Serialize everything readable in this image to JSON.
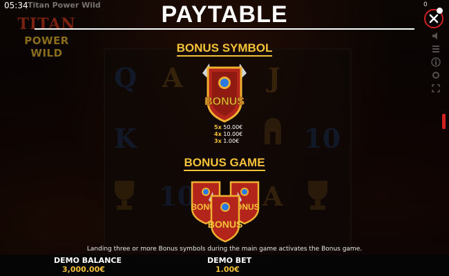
{
  "status": {
    "time": "05:34",
    "game_title": "Titan Power Wild",
    "counter": "0"
  },
  "logo": {
    "line1": "TITAN",
    "line2": "POWER WILD"
  },
  "paytable": {
    "title": "PAYTABLE",
    "bonus_symbol": {
      "heading": "BONUS SYMBOL",
      "symbol_text": "BONUS",
      "payouts": [
        {
          "count": "5x",
          "value": "50.00€"
        },
        {
          "count": "4x",
          "value": "10.00€"
        },
        {
          "count": "3x",
          "value": "1.00€"
        }
      ]
    },
    "bonus_game": {
      "heading": "BONUS GAME",
      "symbol_text": "BONUS",
      "description": "Landing three or more Bonus symbols during the main game activates the Bonus game."
    }
  },
  "reels": {
    "symbols": [
      "Q",
      "A",
      "J",
      "K",
      "10",
      "10",
      "A"
    ]
  },
  "footer": {
    "balance_label": "DEMO BALANCE",
    "balance_value": "3,000.00€",
    "bet_label": "DEMO BET",
    "bet_value": "1.00€"
  },
  "icons": [
    "close-icon",
    "sound-icon",
    "menu-icon",
    "info-icon",
    "settings-icon",
    "fullscreen-icon",
    "bonus-shield-icon"
  ],
  "colors": {
    "accent": "#f3c238",
    "close": "#d21f1f",
    "shield_red": "#b3241a",
    "gem": "#2a7ae6"
  }
}
